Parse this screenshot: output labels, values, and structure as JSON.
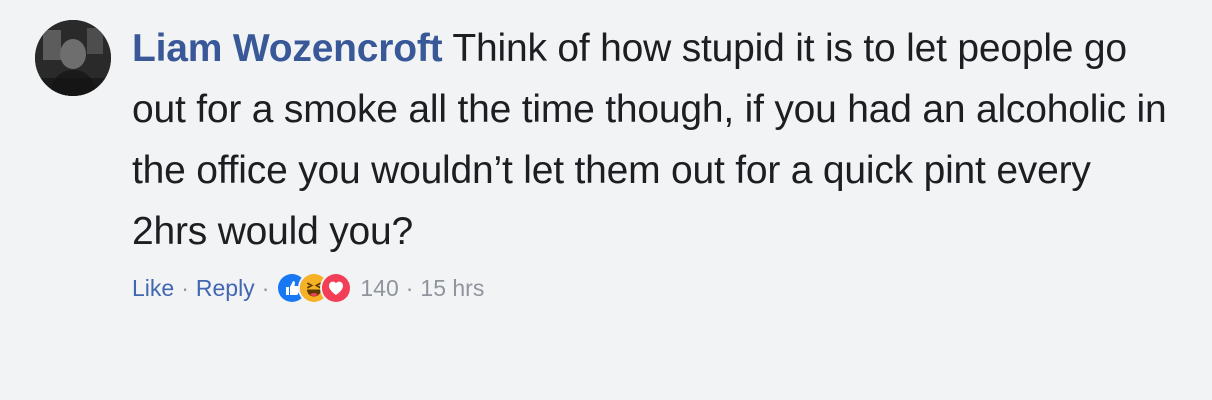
{
  "comment": {
    "author": "Liam Wozencroft",
    "text": "Think of how stupid it is to let people go out for a smoke all the time though, if you had an alcoholic in the office you wouldn’t let them out for a quick pint every 2hrs would you?",
    "actions": {
      "like_label": "Like",
      "reply_label": "Reply",
      "separator": "·",
      "reaction_icons": [
        "like-icon",
        "haha-icon",
        "love-icon"
      ],
      "reaction_count": "140",
      "timestamp": "15 hrs"
    }
  },
  "colors": {
    "background": "#f2f3f5",
    "author": "#385898",
    "link": "#4267b2",
    "meta": "#90949c",
    "text": "#1c1e21",
    "like": "#1877f2",
    "haha": "#f7b125",
    "love": "#f33e58"
  }
}
